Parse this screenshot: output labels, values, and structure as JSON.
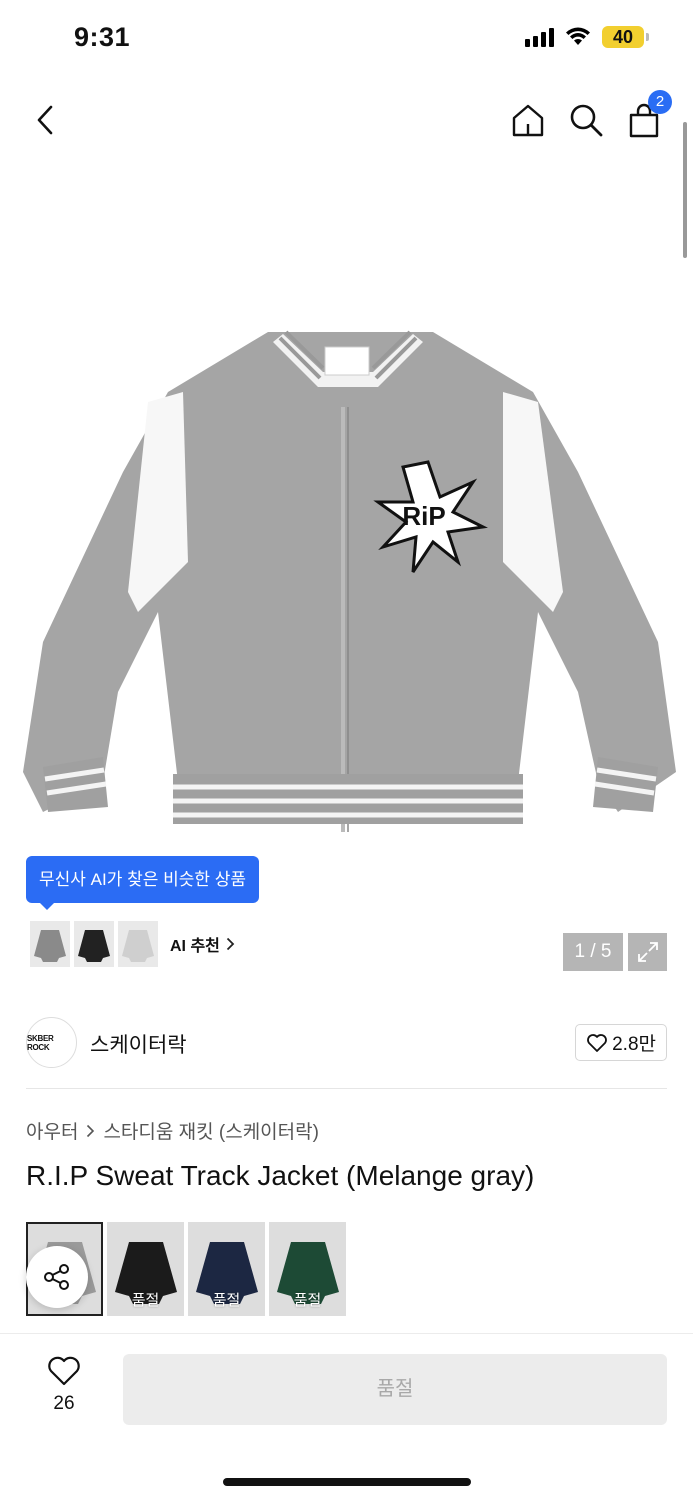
{
  "status_bar": {
    "time": "9:31",
    "battery": "40"
  },
  "nav": {
    "cart_count": "2"
  },
  "gallery": {
    "ai_tooltip": "무신사 AI가 찾은 비슷한 상품",
    "ai_recommend_label": "AI 추천",
    "page_counter": "1 / 5"
  },
  "brand": {
    "logo_text": "SKBER ROCK",
    "name": "스케이터락",
    "like_count": "2.8만"
  },
  "product": {
    "breadcrumb": [
      "아우터",
      "스타디움 재킷 (스케이터락)"
    ],
    "title": "R.I.P Sweat Track Jacket (Melange gray)",
    "variants": [
      {
        "color": "#9a9a9a",
        "sold_out_label": ""
      },
      {
        "color": "#1b1b1b",
        "sold_out_label": "품절"
      },
      {
        "color": "#1c2742",
        "sold_out_label": "품절"
      },
      {
        "color": "#1d4a35",
        "sold_out_label": "품절"
      }
    ]
  },
  "bottom_bar": {
    "like_count": "26",
    "buy_button_label": "품절"
  }
}
